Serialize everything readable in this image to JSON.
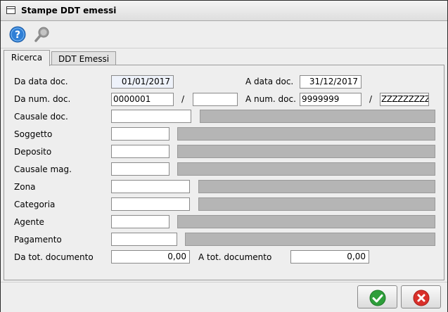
{
  "window": {
    "title": "Stampe DDT emessi"
  },
  "toolbar": {
    "help_icon": "help-icon",
    "search_icon": "search-icon"
  },
  "tabs": [
    {
      "label": "Ricerca",
      "active": true
    },
    {
      "label": "DDT Emessi",
      "active": false
    }
  ],
  "form": {
    "da_data_doc": {
      "label": "Da data doc.",
      "value": "01/01/2017"
    },
    "a_data_doc": {
      "label": "A data doc.",
      "value": "31/12/2017"
    },
    "da_num_doc": {
      "label": "Da num. doc.",
      "value": "0000001",
      "series": ""
    },
    "separator": "/",
    "a_num_doc": {
      "label": "A num. doc.",
      "value": "9999999",
      "series": "ZZZZZZZZZZ"
    },
    "causale_doc": {
      "label": "Causale doc.",
      "code": "",
      "description": ""
    },
    "soggetto": {
      "label": "Soggetto",
      "code": "",
      "description": ""
    },
    "deposito": {
      "label": "Deposito",
      "code": "",
      "description": ""
    },
    "causale_mag": {
      "label": "Causale mag.",
      "code": "",
      "description": ""
    },
    "zona": {
      "label": "Zona",
      "code": "",
      "description": ""
    },
    "categoria": {
      "label": "Categoria",
      "code": "",
      "description": ""
    },
    "agente": {
      "label": "Agente",
      "code": "",
      "description": ""
    },
    "pagamento": {
      "label": "Pagamento",
      "code": "",
      "description": ""
    },
    "da_tot_documento": {
      "label": "Da tot. documento",
      "value": "0,00"
    },
    "a_tot_documento": {
      "label": "A tot. documento",
      "value": "0,00"
    }
  },
  "footer": {
    "confirm_icon": "check-icon",
    "cancel_icon": "close-icon"
  },
  "colors": {
    "confirm": "#2e9e3a",
    "cancel": "#d9302a",
    "help": "#2f7fd6",
    "disabled_field": "#b5b5b5"
  }
}
